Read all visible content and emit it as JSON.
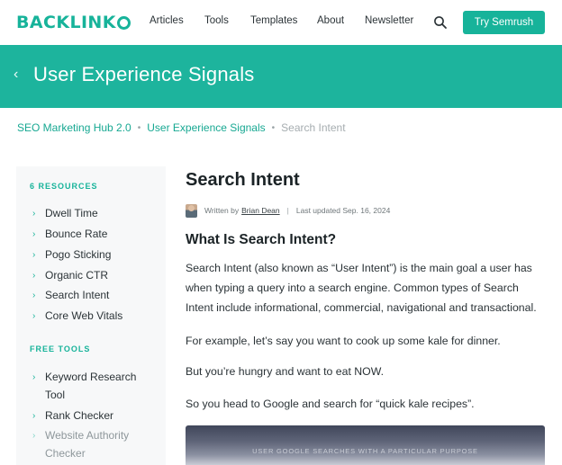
{
  "header": {
    "logo_text": "BACKLINK",
    "nav": [
      "Articles",
      "Tools",
      "Templates",
      "About",
      "Newsletter"
    ],
    "cta_label": "Try Semrush",
    "brand_color": "#17b39a"
  },
  "hero": {
    "back_icon": "chevron-left-icon",
    "title": "User Experience Signals"
  },
  "breadcrumb": {
    "items": [
      "SEO Marketing Hub 2.0",
      "User Experience Signals"
    ],
    "current": "Search Intent",
    "separator": "•"
  },
  "sidebar": {
    "resources_heading": "6 RESOURCES",
    "resources": [
      "Dwell Time",
      "Bounce Rate",
      "Pogo Sticking",
      "Organic CTR",
      "Search Intent",
      "Core Web Vitals"
    ],
    "tools_heading": "FREE TOOLS",
    "tools": [
      "Keyword Research Tool",
      "Rank Checker",
      "Website Authority Checker"
    ]
  },
  "article": {
    "title": "Search Intent",
    "byline_prefix": "Written by",
    "author": "Brian Dean",
    "byline_separator": "|",
    "updated": "Last updated Sep. 16, 2024",
    "h2": "What Is Search Intent?",
    "paragraphs": [
      "Search Intent (also known as “User Intent”) is the main goal a user has when typing a query into a search engine. Common types of Search Intent include informational, commercial, navigational and transactional.",
      "For example, let’s say you want to cook up some kale for dinner.",
      "But you’re hungry and want to eat NOW.",
      "So you head to Google and search for “quick kale recipes”."
    ],
    "image_caption": "USER GOOGLE SEARCHES WITH A PARTICULAR PURPOSE"
  }
}
